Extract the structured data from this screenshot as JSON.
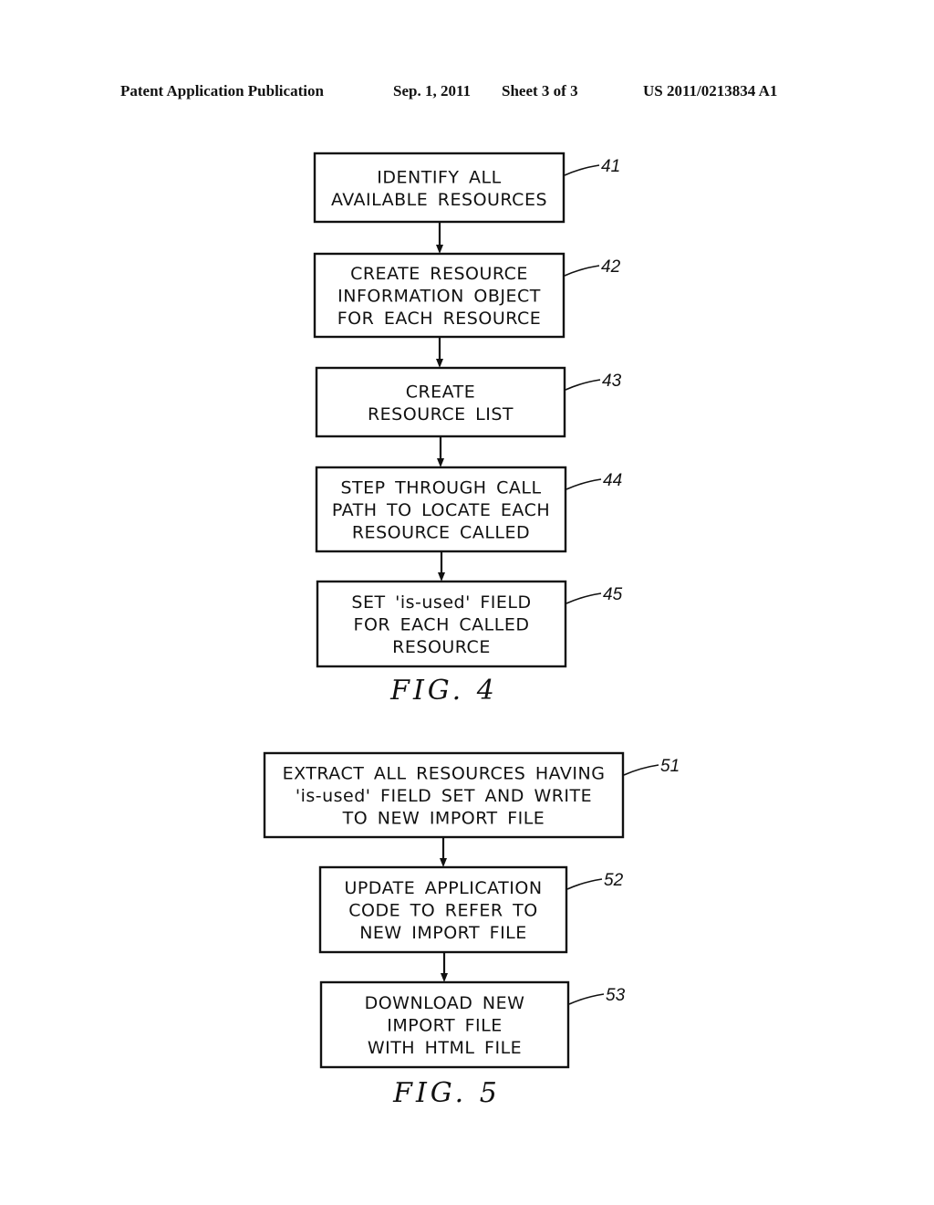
{
  "header": {
    "publication": "Patent Application Publication",
    "date": "Sep. 1, 2011",
    "sheet": "Sheet 3 of 3",
    "number": "US 2011/0213834 A1"
  },
  "figures": [
    {
      "label": "FIG. 4",
      "steps": [
        {
          "ref": "41",
          "lines": [
            "IDENTIFY ALL",
            "AVAILABLE RESOURCES"
          ]
        },
        {
          "ref": "42",
          "lines": [
            "CREATE RESOURCE",
            "INFORMATION OBJECT",
            "FOR EACH RESOURCE"
          ]
        },
        {
          "ref": "43",
          "lines": [
            "CREATE",
            "RESOURCE LIST"
          ]
        },
        {
          "ref": "44",
          "lines": [
            "STEP THROUGH CALL",
            "PATH TO LOCATE EACH",
            "RESOURCE CALLED"
          ]
        },
        {
          "ref": "45",
          "lines": [
            "SET 'is-used' FIELD",
            "FOR EACH CALLED",
            "RESOURCE"
          ]
        }
      ]
    },
    {
      "label": "FIG. 5",
      "steps": [
        {
          "ref": "51",
          "lines": [
            "EXTRACT ALL RESOURCES HAVING",
            "'is-used' FIELD SET AND WRITE",
            "TO NEW IMPORT FILE"
          ]
        },
        {
          "ref": "52",
          "lines": [
            "UPDATE APPLICATION",
            "CODE TO REFER TO",
            "NEW IMPORT FILE"
          ]
        },
        {
          "ref": "53",
          "lines": [
            "DOWNLOAD NEW",
            "IMPORT FILE",
            "WITH HTML FILE"
          ]
        }
      ]
    }
  ]
}
